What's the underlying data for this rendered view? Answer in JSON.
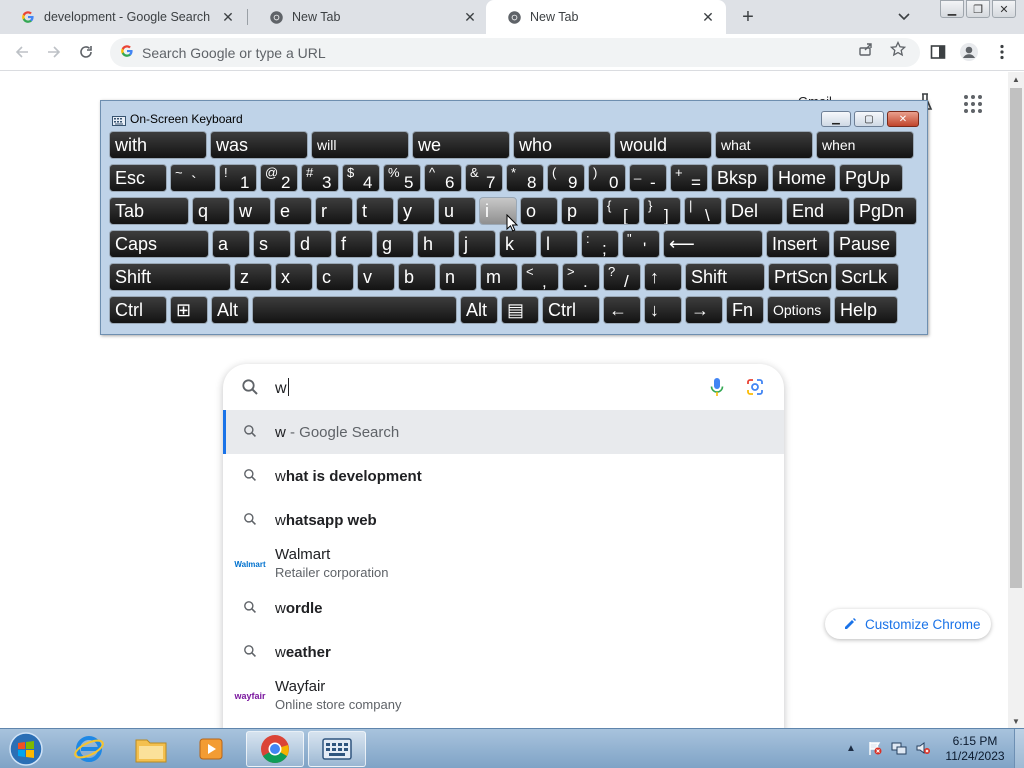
{
  "browser": {
    "tabs": [
      {
        "title": "development - Google Search",
        "favicon": "google-g-icon",
        "active": false
      },
      {
        "title": "New Tab",
        "favicon": "chrome-icon",
        "active": false
      },
      {
        "title": "New Tab",
        "favicon": "chrome-icon",
        "active": true
      }
    ],
    "omnibox_placeholder": "Search Google or type a URL"
  },
  "page": {
    "top_links": {
      "gmail": "Gmail"
    },
    "search": {
      "query": "w",
      "suggestions": [
        {
          "type": "search",
          "bold": "w",
          "rest": " - Google Search",
          "selected": true
        },
        {
          "type": "search",
          "prefix": "w",
          "bold": "hat is development"
        },
        {
          "type": "search",
          "prefix": "w",
          "bold": "hatsapp web"
        },
        {
          "type": "entity",
          "prefix": "W",
          "rest": "almart",
          "subtitle": "Retailer corporation",
          "logo": "Walmart"
        },
        {
          "type": "search",
          "prefix": "w",
          "bold": "ordle"
        },
        {
          "type": "search",
          "prefix": "w",
          "bold": "eather"
        },
        {
          "type": "entity",
          "prefix": "W",
          "rest": "ayfair",
          "subtitle": "Online store company",
          "logo": "wayfair"
        }
      ]
    },
    "customize_label": "Customize Chrome"
  },
  "osk": {
    "title": "On-Screen Keyboard",
    "rows": {
      "predict": [
        "with",
        "was",
        "will",
        "we",
        "who",
        "would",
        "what",
        "when"
      ],
      "r1": [
        "Esc",
        "~`",
        "!1",
        "@2",
        "#3",
        "$4",
        "%5",
        "^6",
        "&7",
        "*8",
        "(9",
        ")0",
        "_-",
        "+=",
        "Bksp",
        "Home",
        "PgUp"
      ],
      "r2": [
        "Tab",
        "q",
        "w",
        "e",
        "r",
        "t",
        "y",
        "u",
        "i",
        "o",
        "p",
        "{[",
        "}]",
        "|\\",
        "Del",
        "End",
        "PgDn"
      ],
      "r3": [
        "Caps",
        "a",
        "s",
        "d",
        "f",
        "g",
        "h",
        "j",
        "k",
        "l",
        ":;",
        "\"'",
        "⟵",
        "Insert",
        "Pause"
      ],
      "r4": [
        "Shift",
        "z",
        "x",
        "c",
        "v",
        "b",
        "n",
        "m",
        "<,",
        ">.",
        "?/",
        "↑",
        "Shift",
        "PrtScn",
        "ScrLk"
      ],
      "r5": [
        "Ctrl",
        "⊞",
        "Alt",
        "",
        "Alt",
        "▤",
        "Ctrl",
        "←",
        "↓",
        "→",
        "Fn",
        "Options",
        "Help"
      ]
    }
  },
  "taskbar": {
    "time": "6:15 PM",
    "date": "11/24/2023",
    "apps": [
      "windows-explorer-icon",
      "internet-explorer-icon",
      "file-explorer-icon",
      "media-player-icon",
      "chrome-icon",
      "on-screen-keyboard-icon"
    ]
  },
  "colors": {
    "accent": "#1a73e8",
    "tabstrip": "#dee1e6",
    "osk_frame": "#bfd3e8",
    "key": "#1f1f1f"
  }
}
